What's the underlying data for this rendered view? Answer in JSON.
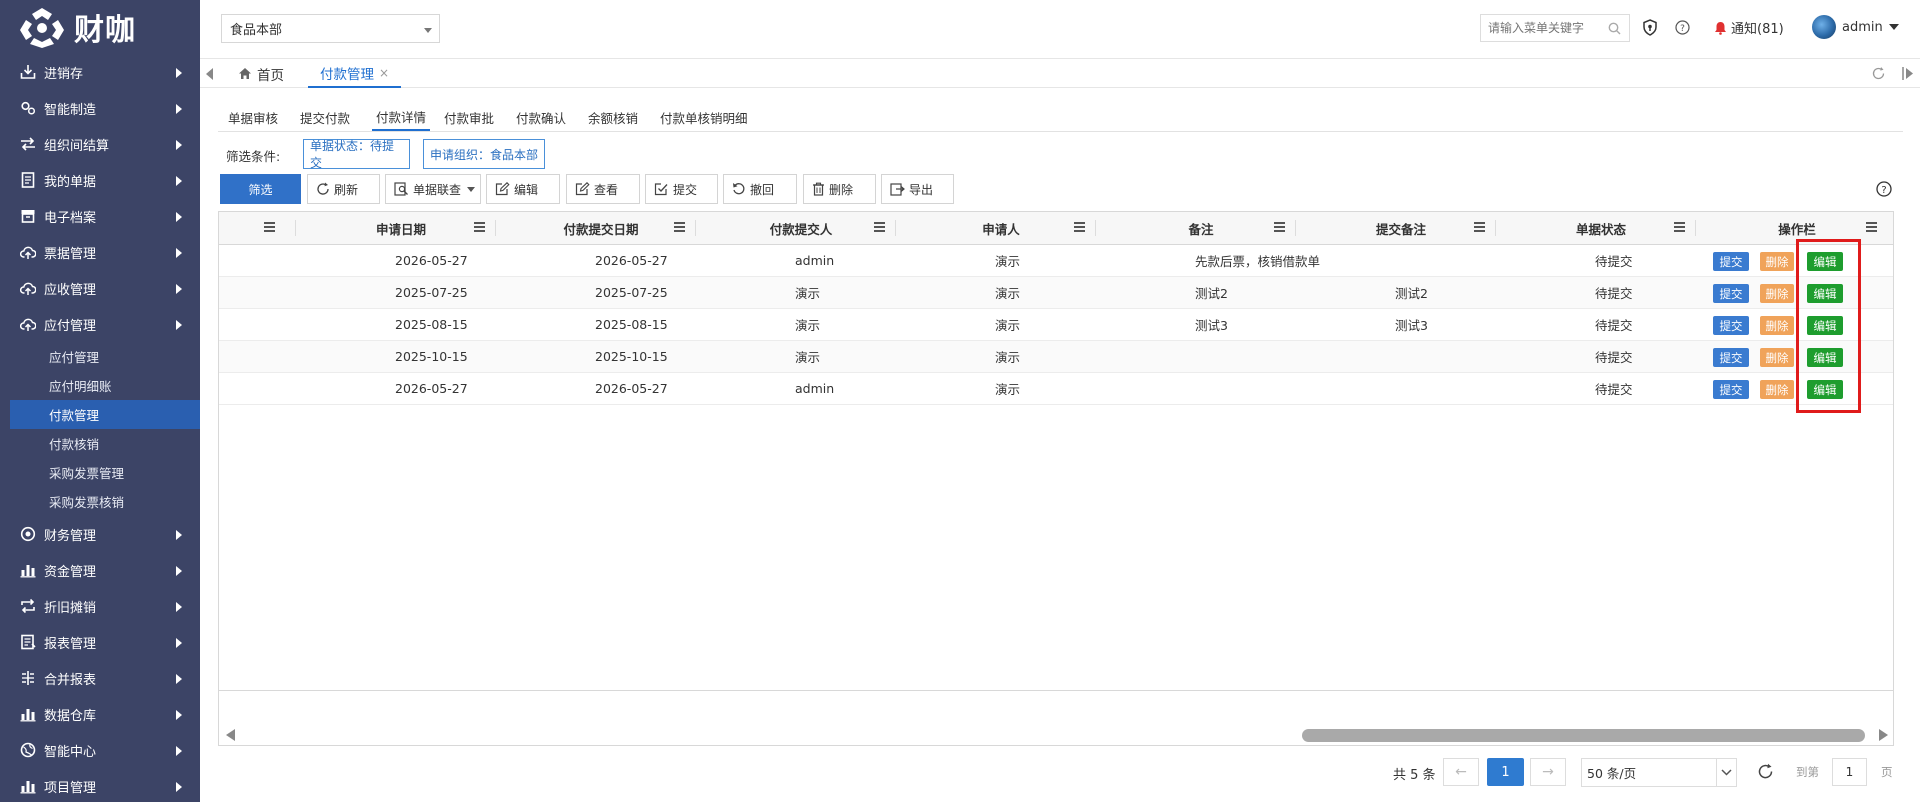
{
  "app": {
    "logo_text": "财咖"
  },
  "sidebar": {
    "items": [
      {
        "label": "进销存",
        "icon": "download-tray-icon"
      },
      {
        "label": "智能制造",
        "icon": "gears-icon"
      },
      {
        "label": "组织间结算",
        "icon": "exchange-icon"
      },
      {
        "label": "我的单据",
        "icon": "document-icon"
      },
      {
        "label": "电子档案",
        "icon": "archive-icon"
      },
      {
        "label": "票据管理",
        "icon": "cloud-upload-icon"
      },
      {
        "label": "应收管理",
        "icon": "cloud-upload-icon"
      },
      {
        "label": "应付管理",
        "icon": "cloud-upload-icon"
      },
      {
        "label": "财务管理",
        "icon": "circle-icon"
      },
      {
        "label": "资金管理",
        "icon": "bar-chart-icon"
      },
      {
        "label": "折旧摊销",
        "icon": "repeat-icon"
      },
      {
        "label": "报表管理",
        "icon": "report-icon"
      },
      {
        "label": "合并报表",
        "icon": "merge-icon"
      },
      {
        "label": "数据仓库",
        "icon": "bar-chart-icon"
      },
      {
        "label": "智能中心",
        "icon": "globe-icon"
      },
      {
        "label": "项目管理",
        "icon": "bar-chart-icon"
      }
    ],
    "sub_items": [
      "应付管理",
      "应付明细账",
      "付款管理",
      "付款核销",
      "采购发票管理",
      "采购发票核销"
    ],
    "active_sub": "付款管理"
  },
  "header": {
    "org_select": "食品本部",
    "search_placeholder": "请输入菜单关键字",
    "notice": "通知(81)",
    "user": "admin"
  },
  "page_tabs": {
    "home": "首页",
    "current": "付款管理",
    "close": "×"
  },
  "sub_tabs": [
    "单据审核",
    "提交付款",
    "付款详情",
    "付款审批",
    "付款确认",
    "余额核销",
    "付款单核销明细"
  ],
  "active_sub_tab": "付款详情",
  "filter": {
    "label": "筛选条件:",
    "chips": [
      "单据状态：待提交",
      "申请组织：食品本部"
    ]
  },
  "toolbar": {
    "filter": "筛选",
    "refresh": "刷新",
    "linked": "单据联查",
    "edit": "编辑",
    "view": "查看",
    "submit": "提交",
    "withdraw": "撤回",
    "delete": "删除",
    "export": "导出"
  },
  "grid": {
    "columns": [
      "申请日期",
      "付款提交日期",
      "付款提交人",
      "申请人",
      "备注",
      "提交备注",
      "单据状态",
      "操作栏"
    ],
    "rows": [
      {
        "apply_date": "2026-05-27",
        "submit_date": "2026-05-27",
        "submitter": "admin",
        "applicant": "演示",
        "remark": "先款后票，核销借款单",
        "submit_remark": "",
        "status": "待提交"
      },
      {
        "apply_date": "2025-07-25",
        "submit_date": "2025-07-25",
        "submitter": "演示",
        "applicant": "演示",
        "remark": "测试2",
        "submit_remark": "测试2",
        "status": "待提交"
      },
      {
        "apply_date": "2025-08-15",
        "submit_date": "2025-08-15",
        "submitter": "演示",
        "applicant": "演示",
        "remark": "测试3",
        "submit_remark": "测试3",
        "status": "待提交"
      },
      {
        "apply_date": "2025-10-15",
        "submit_date": "2025-10-15",
        "submitter": "演示",
        "applicant": "演示",
        "remark": "",
        "submit_remark": "",
        "status": "待提交"
      },
      {
        "apply_date": "2026-05-27",
        "submit_date": "2026-05-27",
        "submitter": "admin",
        "applicant": "演示",
        "remark": "",
        "submit_remark": "",
        "status": "待提交"
      }
    ],
    "actions": {
      "submit": "提交",
      "delete": "删除",
      "edit": "编辑"
    }
  },
  "pagination": {
    "total": "共 5 条",
    "prev": "←",
    "next": "→",
    "current": "1",
    "page_size": "50 条/页",
    "goto_label": "到第",
    "goto_value": "1",
    "page_suffix": "页"
  },
  "colors": {
    "sidebar_bg": "#3c4466",
    "primary": "#3071c8",
    "edit_btn": "#1e9d2e",
    "delete_btn": "#f0a35a",
    "highlight_box": "#e01b1b"
  }
}
